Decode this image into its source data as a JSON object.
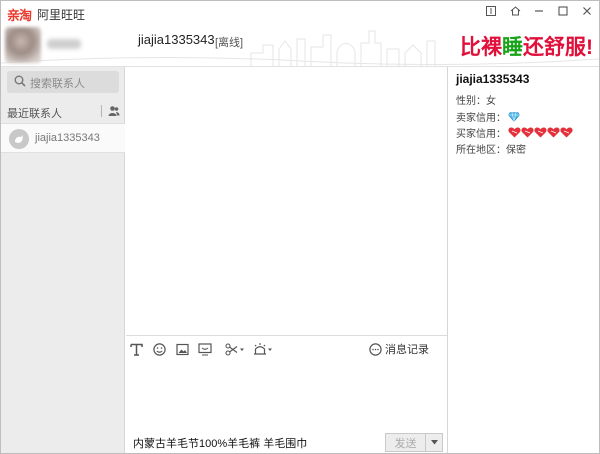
{
  "titlebar": {
    "logo_text": "亲淘",
    "app_name": "阿里旺旺",
    "controls": [
      "pin-icon",
      "home-icon",
      "minimize-icon",
      "maximize-icon",
      "close-icon"
    ]
  },
  "header": {
    "chat_name": "jiajia1335343",
    "chat_status": "[离线]",
    "slogan_parts": [
      {
        "text": "比",
        "color": "#e0103b"
      },
      {
        "text": "裸",
        "color": "#e0103b"
      },
      {
        "text": "睡",
        "color": "#19a319"
      },
      {
        "text": "还",
        "color": "#e0103b"
      },
      {
        "text": "舒",
        "color": "#e0103b"
      },
      {
        "text": "服",
        "color": "#e0103b"
      },
      {
        "text": "!",
        "color": "#e0103b"
      }
    ]
  },
  "sidebar": {
    "search_placeholder": "搜索联系人",
    "recent_label": "最近联系人",
    "contacts": [
      {
        "name": "jiajia1335343"
      }
    ]
  },
  "toolbar": {
    "tools": [
      "font-icon",
      "emoji-icon",
      "image-icon",
      "screen-icon",
      "scissors-icon",
      "ring-icon"
    ],
    "history_label": "消息记录"
  },
  "bottom": {
    "promo_text": "内蒙古羊毛节100%羊毛裤 羊毛围巾",
    "send_label": "发送"
  },
  "profile": {
    "name": "jiajia1335343",
    "gender_label": "性别：",
    "gender": "女",
    "seller_credit_label": "卖家信用：",
    "buyer_credit_label": "买家信用：",
    "buyer_hearts": 5,
    "region_label": "所在地区：",
    "region": "保密"
  },
  "colors": {
    "accent": "#e8392c",
    "sidebar_bg": "#ececec",
    "heart": "#e4303a",
    "diamond": "#4db6e8"
  }
}
